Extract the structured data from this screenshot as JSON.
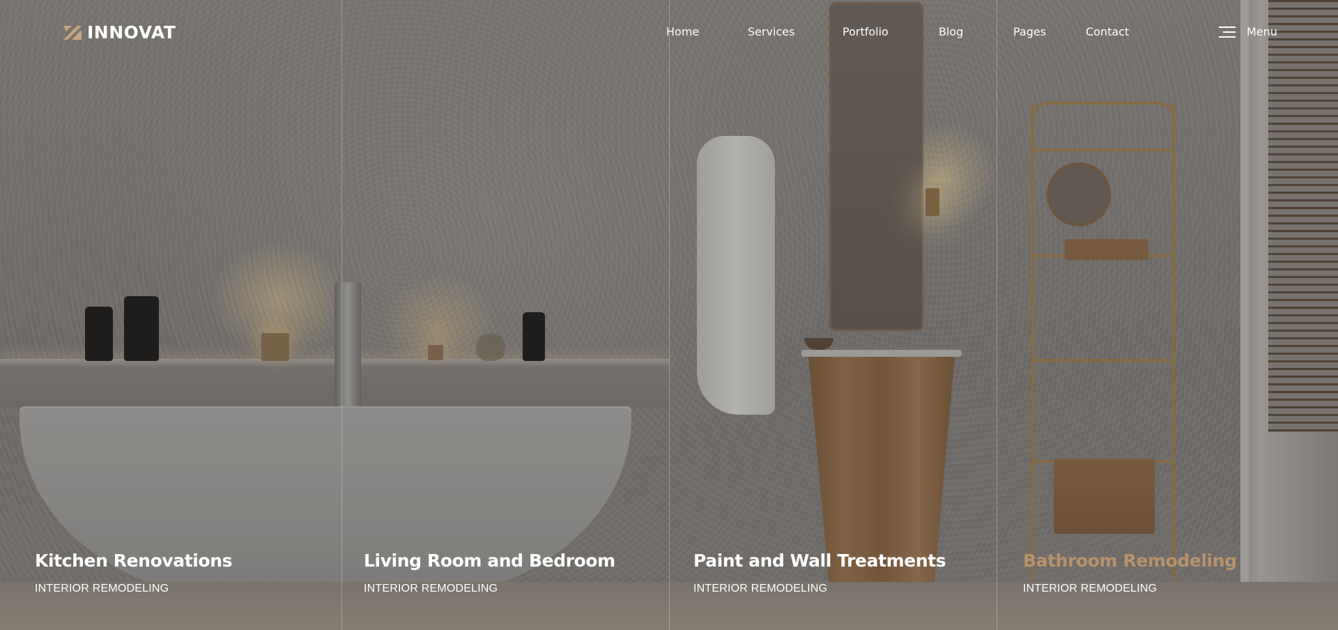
{
  "brand": {
    "name": "INNOVAT",
    "logo_icon": "innovat-logo-mark-icon",
    "accent_color": "#b8926a"
  },
  "nav": {
    "items": [
      {
        "label": "Home"
      },
      {
        "label": "Services"
      },
      {
        "label": "Portfolio"
      },
      {
        "label": "Blog"
      },
      {
        "label": "Pages"
      },
      {
        "label": "Contact"
      }
    ],
    "menu": {
      "icon": "hamburger-menu-icon",
      "label": "Menu"
    }
  },
  "cards": [
    {
      "title": "Kitchen Renovations",
      "subtitle": "INTERIOR REMODELING",
      "active": false
    },
    {
      "title": "Living Room and Bedroom",
      "subtitle": "INTERIOR REMODELING",
      "active": false
    },
    {
      "title": "Paint and Wall Treatments",
      "subtitle": "INTERIOR REMODELING",
      "active": false
    },
    {
      "title": "Bathroom Remodeling",
      "subtitle": "INTERIOR REMODELING",
      "active": true
    }
  ]
}
